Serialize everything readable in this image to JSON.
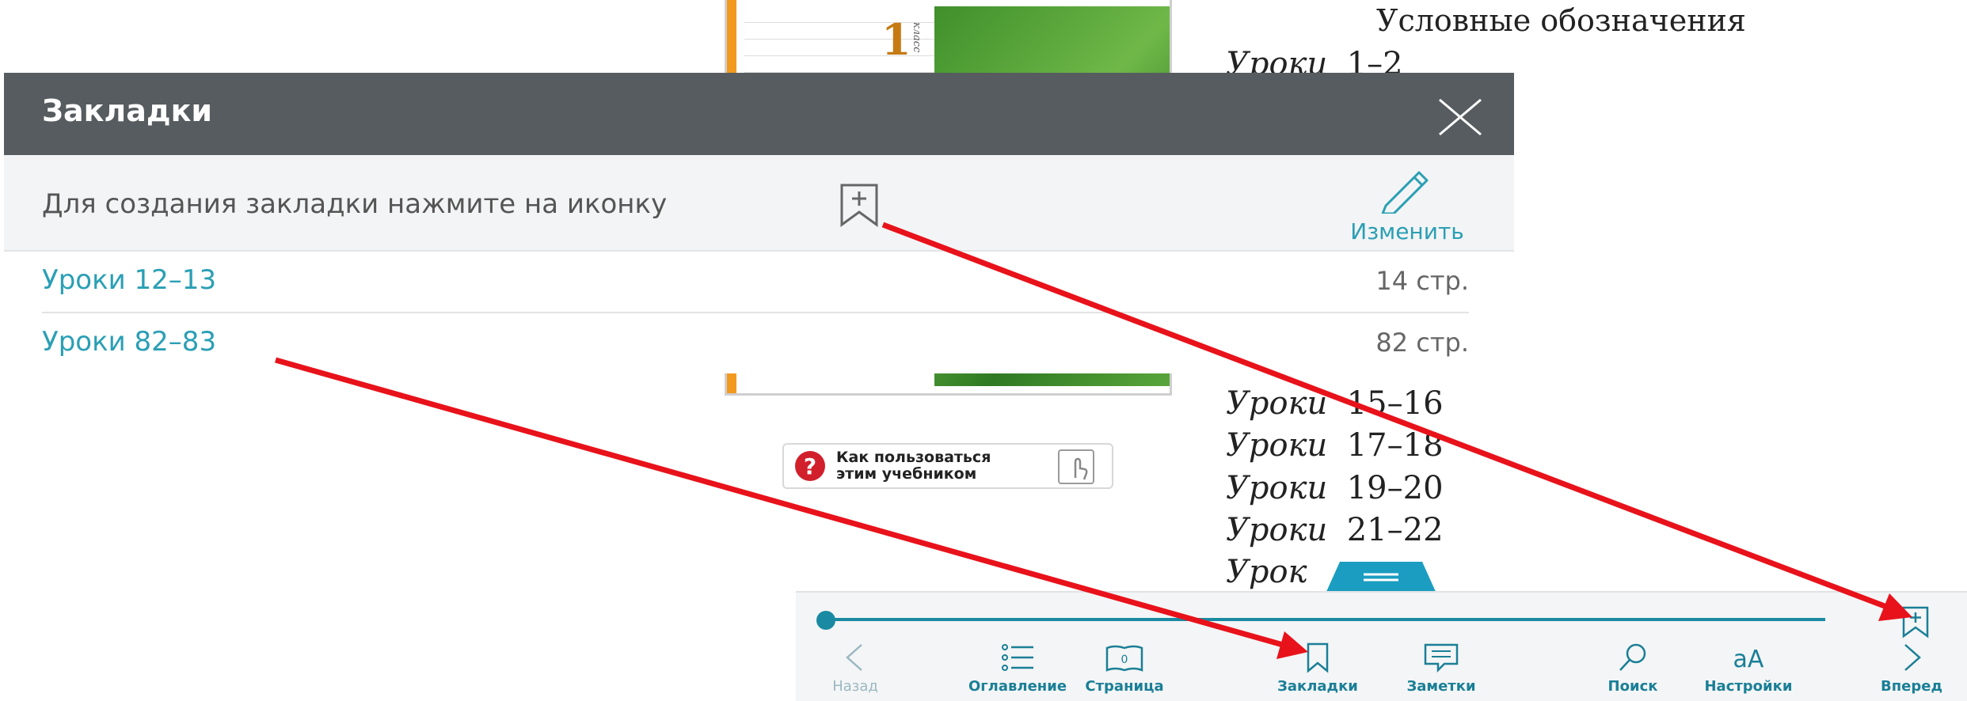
{
  "book": {
    "grade_number": "1",
    "grade_word": "класс",
    "toc_title": "Условные обозначения",
    "toc_word": "Уроки",
    "toc_rows": [
      {
        "word": "Уроки",
        "range": "1–2"
      },
      {
        "word": "Уроки",
        "range": "15–16"
      },
      {
        "word": "Уроки",
        "range": "17–18"
      },
      {
        "word": "Уроки",
        "range": "19–20"
      },
      {
        "word": "Уроки",
        "range": "21–22"
      },
      {
        "word": "Урок",
        "range": ""
      }
    ],
    "help_button": {
      "line1": "Как пользоваться",
      "line2": "этим учебником"
    }
  },
  "bookmarks_panel": {
    "title": "Закладки",
    "hint": "Для создания закладки нажмите на иконку",
    "edit_label": "Изменить",
    "items": [
      {
        "title": "Уроки 12–13",
        "page": "14 стр."
      },
      {
        "title": "Уроки 82–83",
        "page": "82 стр."
      }
    ]
  },
  "toolbar": {
    "back": "Назад",
    "toc": "Оглавление",
    "page": "Страница",
    "page_number": "0",
    "bookmarks": "Закладки",
    "notes": "Заметки",
    "search": "Поиск",
    "settings": "Настройки",
    "forward": "Вперед"
  },
  "colors": {
    "header_bg": "#565c5f",
    "accent": "#2a9fb5",
    "toolbar_accent": "#1a8aa3",
    "annotation_red": "#e8121b"
  }
}
